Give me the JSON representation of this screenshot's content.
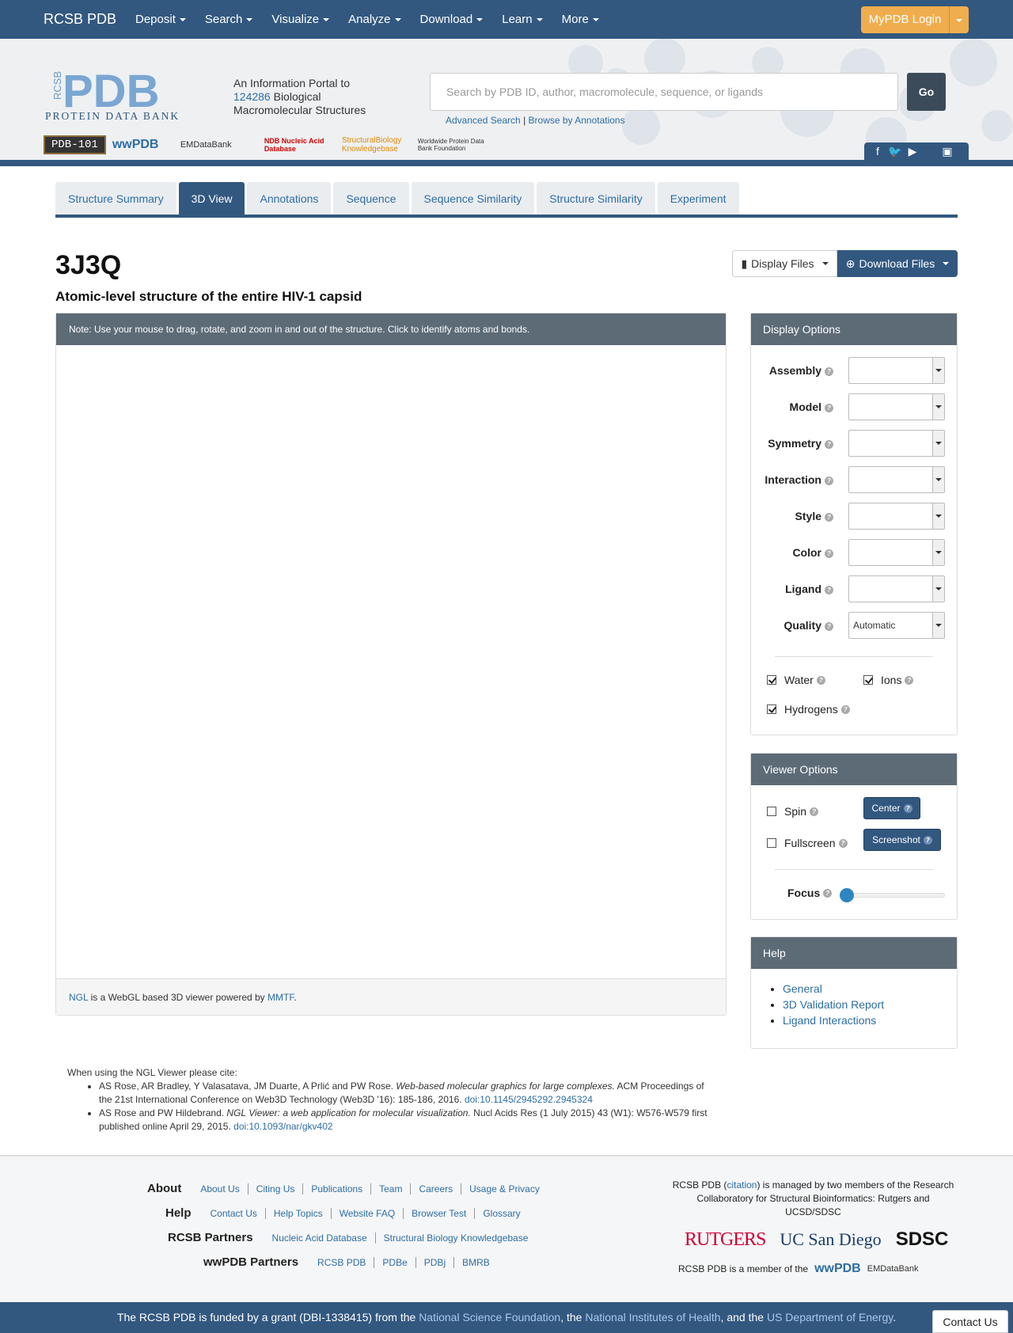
{
  "nav": {
    "brand": "RCSB PDB",
    "menu": [
      "Deposit",
      "Search",
      "Visualize",
      "Analyze",
      "Download",
      "Learn",
      "More"
    ],
    "login": "MyPDB Login"
  },
  "header": {
    "logo_text": "PDB",
    "logo_sub": "PROTEIN DATA BANK",
    "logo_rcsb": "RCSB",
    "tagline_1": "An Information Portal to",
    "tagline_count": "124286",
    "tagline_2": "Biological",
    "tagline_3": "Macromolecular Structures",
    "search_placeholder": "Search by PDB ID, author, macromolecule, sequence, or ligands",
    "go": "Go",
    "advanced_search": "Advanced Search",
    "browse": "Browse by Annotations",
    "partner_logos": [
      "PDB-101",
      "wwPDB",
      "EMDataBank",
      "NDB Nucleic Acid Database",
      "StructuralBiology Knowledgebase",
      "Worldwide Protein Data Bank Foundation"
    ]
  },
  "tabs": [
    "Structure Summary",
    "3D View",
    "Annotations",
    "Sequence",
    "Sequence Similarity",
    "Structure Similarity",
    "Experiment"
  ],
  "active_tab": "3D View",
  "entry": {
    "id": "3J3Q",
    "title": "Atomic-level structure of the entire HIV-1 capsid",
    "display_files": "Display Files",
    "download_files": "Download Files"
  },
  "viewer": {
    "note": "Note: Use your mouse to drag, rotate, and zoom in and out of the structure. Click to identify atoms and bonds.",
    "footer_link1": "NGL",
    "footer_text": " is a WebGL based 3D viewer powered by ",
    "footer_link2": "MMTF",
    "footer_end": "."
  },
  "display_options": {
    "title": "Display Options",
    "rows": [
      {
        "label": "Assembly",
        "value": ""
      },
      {
        "label": "Model",
        "value": ""
      },
      {
        "label": "Symmetry",
        "value": ""
      },
      {
        "label": "Interaction",
        "value": ""
      },
      {
        "label": "Style",
        "value": ""
      },
      {
        "label": "Color",
        "value": ""
      },
      {
        "label": "Ligand",
        "value": ""
      },
      {
        "label": "Quality",
        "value": "Automatic"
      }
    ],
    "water": "Water",
    "ions": "Ions",
    "hydrogens": "Hydrogens"
  },
  "viewer_options": {
    "title": "Viewer Options",
    "spin": "Spin",
    "fullscreen": "Fullscreen",
    "center": "Center",
    "screenshot": "Screenshot",
    "focus": "Focus",
    "focus_value": 0
  },
  "help": {
    "title": "Help",
    "links": [
      "General",
      "3D Validation Report",
      "Ligand Interactions"
    ]
  },
  "citations": {
    "intro": "When using the NGL Viewer please cite:",
    "c1_authors": "AS Rose, AR Bradley, Y Valasatava, JM Duarte, A Prlić and PW Rose. ",
    "c1_title": "Web-based molecular graphics for large complexes.",
    "c1_rest": " ACM Proceedings of the 21st International Conference on Web3D Technology (Web3D '16): 185-186, 2016. ",
    "c1_doi": "doi:10.1145/2945292.2945324",
    "c2_authors": "AS Rose and PW Hildebrand. ",
    "c2_title": "NGL Viewer: a web application for molecular visualization.",
    "c2_rest": " Nucl Acids Res (1 July 2015) 43 (W1): W576-W579 first published online April 29, 2015. ",
    "c2_doi": "doi:10.1093/nar/gkv402"
  },
  "footer": {
    "about": {
      "label": "About",
      "links": [
        "About Us",
        "Citing Us",
        "Publications",
        "Team",
        "Careers",
        "Usage & Privacy"
      ]
    },
    "help": {
      "label": "Help",
      "links": [
        "Contact Us",
        "Help Topics",
        "Website FAQ",
        "Browser Test",
        "Glossary"
      ]
    },
    "rcsb_partners": {
      "label": "RCSB Partners",
      "links": [
        "Nucleic Acid Database",
        "Structural Biology Knowledgebase"
      ]
    },
    "wwpdb_partners": {
      "label": "wwPDB Partners",
      "links": [
        "RCSB PDB",
        "PDBe",
        "PDBj",
        "BMRB"
      ]
    },
    "managed_1": "RCSB PDB (",
    "managed_link": "citation",
    "managed_2": ") is managed by two members of the Research Collaboratory for Structural Bioinformatics: Rutgers and UCSD/SDSC",
    "rutgers": "RUTGERS",
    "ucsd": "UC San Diego",
    "sdsc": "SDSC",
    "member": "RCSB PDB is a member of the",
    "funding_1": "The RCSB PDB is funded by a grant (DBI-1338415) from the ",
    "funding_nsf": "National Science Foundation",
    "funding_2": ", the ",
    "funding_nih": "National Institutes of Health",
    "funding_3": ", and the ",
    "funding_doe": "US Department of Energy",
    "funding_4": ".",
    "contact": "Contact Us"
  },
  "colors": {
    "primary": "#325880",
    "login": "#f0ad4e",
    "panel_header": "#5d6b77",
    "link": "#2e6da4"
  }
}
